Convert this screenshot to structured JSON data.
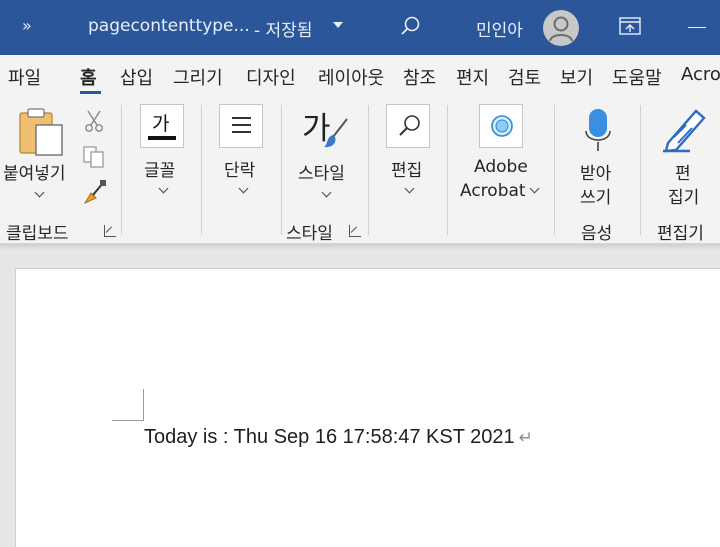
{
  "titlebar": {
    "more": "»",
    "doc_name": "pagecontenttype...",
    "save_status": "- 저장됨",
    "user_name": "민인아"
  },
  "tabs": [
    {
      "label": "파일"
    },
    {
      "label": "홈"
    },
    {
      "label": "삽입"
    },
    {
      "label": "그리기"
    },
    {
      "label": "디자인"
    },
    {
      "label": "레이아웃"
    },
    {
      "label": "참조"
    },
    {
      "label": "편지"
    },
    {
      "label": "검토"
    },
    {
      "label": "보기"
    },
    {
      "label": "도움말"
    },
    {
      "label": "Acro"
    }
  ],
  "ribbon": {
    "clipboard": {
      "paste_label": "붙여넣기",
      "group_label": "클립보드"
    },
    "font": {
      "icon_char": "가",
      "label": "글꼴"
    },
    "paragraph": {
      "label": "단락"
    },
    "styles": {
      "icon_char": "가",
      "label": "스타일",
      "group_label": "스타일"
    },
    "editing": {
      "label": "편집"
    },
    "acrobat": {
      "label_line1": "Adobe",
      "label_line2": "Acrobat"
    },
    "dictate": {
      "label_line1": "받아",
      "label_line2": "쓰기",
      "group_label": "음성"
    },
    "editor": {
      "label_line1": "편",
      "label_line2": "집기",
      "group_label": "편집기"
    }
  },
  "document": {
    "line": "Today is : Thu Sep 16 17:58:47 KST 2021",
    "pilcrow": "↵"
  },
  "colors": {
    "titlebar": "#2b579a",
    "ribbon": "#f3f3f3",
    "accent": "#2b579a",
    "workspace": "#e6e6e6"
  }
}
